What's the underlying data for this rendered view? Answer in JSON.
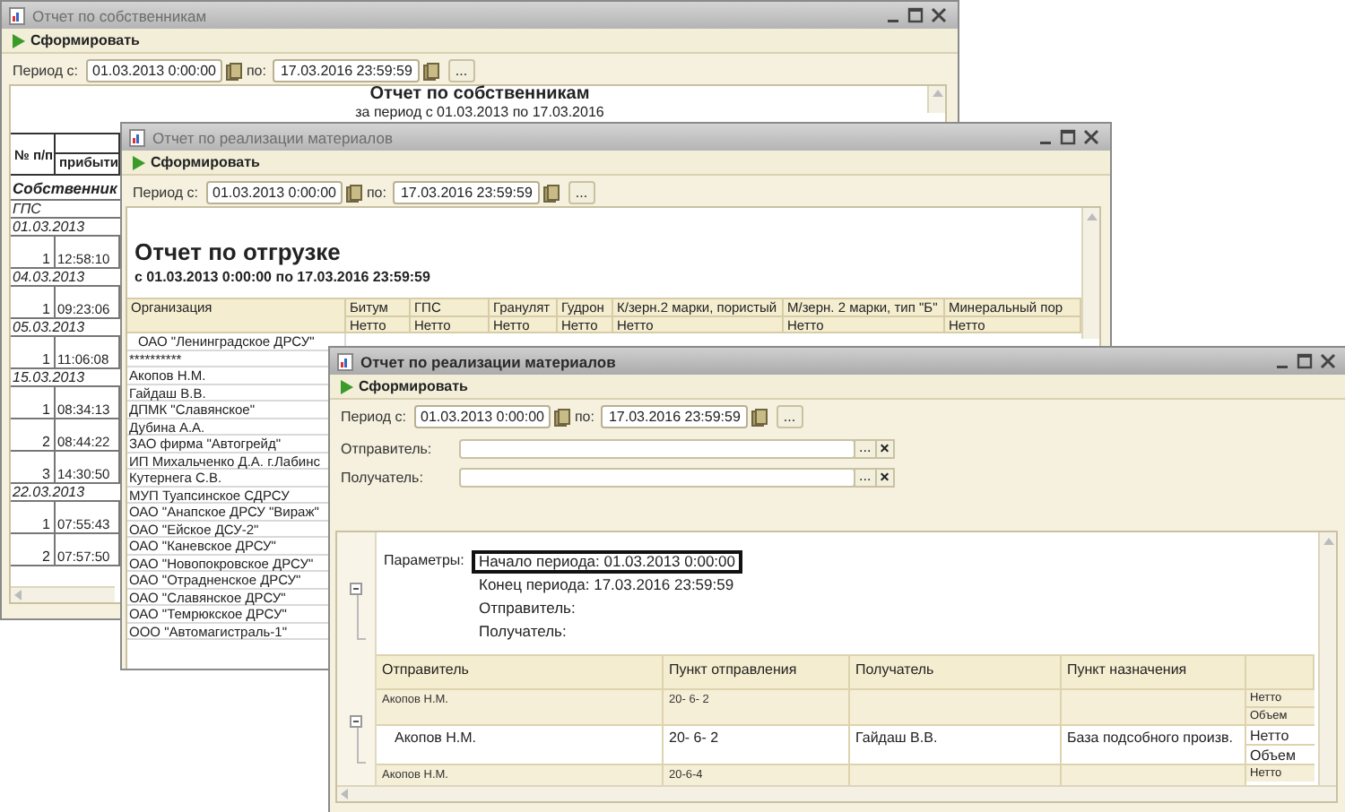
{
  "windows": [
    {
      "kind": "owners",
      "title": "Отчет по собственникам",
      "active": false,
      "run_button": "Сформировать",
      "period": {
        "label": "Период с:",
        "from": "01.03.2013  0:00:00",
        "to_label": "по:",
        "to": "17.03.2016 23:59:59",
        "more": "..."
      },
      "report": {
        "title": "Отчет по собственникам",
        "subtitle": "за период с 01.03.2013 по 17.03.2016",
        "columns": [
          "№ п/п",
          "прибыти"
        ],
        "rows": [
          {
            "kind": "section",
            "text": "Собственник"
          },
          {
            "kind": "group",
            "text": "ГПС"
          },
          {
            "kind": "group",
            "text": "01.03.2013"
          },
          {
            "kind": "item",
            "number": "1",
            "time": "12:58:10"
          },
          {
            "kind": "group",
            "text": "04.03.2013"
          },
          {
            "kind": "item",
            "number": "1",
            "time": "09:23:06"
          },
          {
            "kind": "group",
            "text": "05.03.2013"
          },
          {
            "kind": "item",
            "number": "1",
            "time": "11:06:08"
          },
          {
            "kind": "group",
            "text": "15.03.2013"
          },
          {
            "kind": "item",
            "number": "1",
            "time": "08:34:13"
          },
          {
            "kind": "item",
            "number": "2",
            "time": "08:44:22"
          },
          {
            "kind": "item",
            "number": "3",
            "time": "14:30:50"
          },
          {
            "kind": "group",
            "text": "22.03.2013"
          },
          {
            "kind": "item",
            "number": "1",
            "time": "07:55:43"
          },
          {
            "kind": "item",
            "number": "2",
            "time": "07:57:50"
          }
        ]
      }
    },
    {
      "kind": "shipment",
      "title": "Отчет по реализации материалов",
      "active": false,
      "run_button": "Сформировать",
      "period": {
        "label": "Период с:",
        "from": "01.03.2013  0:00:00",
        "to_label": "по:",
        "to": "17.03.2016 23:59:59",
        "more": "..."
      },
      "report": {
        "title": "Отчет по отгрузке",
        "subtitle": "с 01.03.2013 0:00:00 по 17.03.2016 23:59:59",
        "first_column": "Организация",
        "columns": [
          {
            "name": "Битум",
            "measure": "Нетто"
          },
          {
            "name": "ГПС",
            "measure": "Нетто"
          },
          {
            "name": "Гранулят",
            "measure": "Нетто"
          },
          {
            "name": "Гудрон",
            "measure": "Нетто"
          },
          {
            "name": "К/зерн.2 марки, пористый",
            "measure": "Нетто"
          },
          {
            "name": "М/зерн. 2 марки, тип \"Б\"",
            "measure": "Нетто"
          },
          {
            "name": "Минеральный пор",
            "measure": "Нетто"
          }
        ],
        "rows": [
          {
            "kind": "group",
            "text": "ОАО \"Ленинградское ДРСУ\""
          },
          {
            "kind": "item",
            "text": "**********"
          },
          {
            "kind": "item",
            "text": "Акопов Н.М."
          },
          {
            "kind": "item",
            "text": "Гайдаш В.В."
          },
          {
            "kind": "item",
            "text": "ДПМК \"Славянское\""
          },
          {
            "kind": "item",
            "text": "Дубина А.А."
          },
          {
            "kind": "item",
            "text": "ЗАО фирма \"Автогрейд\""
          },
          {
            "kind": "item",
            "text": "ИП Михальченко Д.А. г.Лабинс"
          },
          {
            "kind": "item",
            "text": "Кутернега С.В."
          },
          {
            "kind": "item",
            "text": "МУП Туапсинское СДРСУ"
          },
          {
            "kind": "item",
            "text": "ОАО \"Анапское ДРСУ \"Вираж\""
          },
          {
            "kind": "item",
            "text": "ОАО \"Ейское ДСУ-2\""
          },
          {
            "kind": "item",
            "text": "ОАО \"Каневское  ДРСУ\""
          },
          {
            "kind": "item",
            "text": "ОАО \"Новопокровское ДРСУ\""
          },
          {
            "kind": "item",
            "text": "ОАО \"Отрадненское ДРСУ\""
          },
          {
            "kind": "item",
            "text": "ОАО \"Славянское ДРСУ\""
          },
          {
            "kind": "item",
            "text": "ОАО \"Темрюкское ДРСУ\""
          },
          {
            "kind": "item",
            "text": "ООО \"Автомагистраль-1\""
          }
        ]
      }
    },
    {
      "kind": "sales",
      "title": "Отчет по реализации материалов",
      "active": true,
      "run_button": "Сформировать",
      "period": {
        "label": "Период с:",
        "from": "01.03.2013  0:00:00",
        "to_label": "по:",
        "to": "17.03.2016 23:59:59",
        "more": "..."
      },
      "filters": [
        {
          "label": "Отправитель:",
          "more": "...",
          "clear": "×"
        },
        {
          "label": "Получатель:",
          "more": "...",
          "clear": "×"
        }
      ],
      "report": {
        "params_label": "Параметры:",
        "params": [
          {
            "text": "Начало периода: 01.03.2013 0:00:00",
            "selected": true
          },
          {
            "text": "Конец периода: 17.03.2016 23:59:59",
            "selected": false
          },
          {
            "text": "Отправитель:",
            "selected": false
          },
          {
            "text": "Получатель:",
            "selected": false
          }
        ],
        "columns": [
          "Отправитель",
          "Пункт отправления",
          "Получатель",
          "Пункт назначения"
        ],
        "rows": [
          {
            "kind": "group",
            "sender": "Акопов Н.М.",
            "from_point": "20- 6- 2",
            "measures": [
              "Нетто",
              "Объем"
            ]
          },
          {
            "kind": "detail",
            "sender": "Акопов Н.М.",
            "from_point": "20- 6- 2",
            "receiver": "Гайдаш В.В.",
            "to_point": "База подсобного произв.",
            "measures": [
              "Нетто",
              "Объем"
            ]
          },
          {
            "kind": "group",
            "sender": "Акопов Н.М.",
            "from_point": "20-6-4",
            "measures": [
              "Нетто"
            ]
          }
        ]
      }
    }
  ]
}
